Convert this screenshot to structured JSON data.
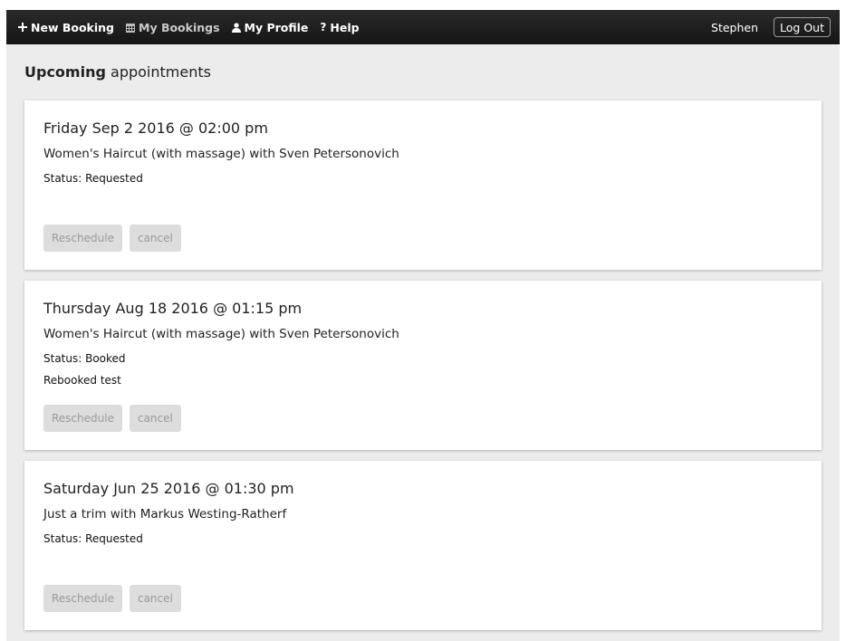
{
  "nav": {
    "new_booking": {
      "icon": "plus-icon",
      "label": "New Booking"
    },
    "my_bookings": {
      "icon": "calendar-icon",
      "label": "My Bookings"
    },
    "my_profile": {
      "icon": "user-icon",
      "label": "My Profile"
    },
    "help": {
      "icon": "question-icon",
      "label": "Help"
    },
    "user_name": "Stephen",
    "logout_label": "Log Out"
  },
  "page": {
    "heading_bold": "Upcoming",
    "heading_rest": "appointments"
  },
  "appointments": [
    {
      "date": "Friday Sep 2 2016 @ 02:00 pm",
      "service": "Women's Haircut (with massage) with Sven Petersonovich",
      "status": "Status: Requested",
      "note": "",
      "reschedule_label": "Reschedule",
      "cancel_label": "cancel"
    },
    {
      "date": "Thursday Aug 18 2016 @ 01:15 pm",
      "service": "Women's Haircut (with massage) with Sven Petersonovich",
      "status": "Status: Booked",
      "note": "Rebooked test",
      "reschedule_label": "Reschedule",
      "cancel_label": "cancel"
    },
    {
      "date": "Saturday Jun 25 2016 @ 01:30 pm",
      "service": "Just a trim with Markus Westing-Ratherf",
      "status": "Status: Requested",
      "note": "",
      "reschedule_label": "Reschedule",
      "cancel_label": "cancel"
    }
  ],
  "colors": {
    "navbar": "#1c1c1c",
    "background": "#ececec",
    "disabled_button": "#dddddd"
  }
}
